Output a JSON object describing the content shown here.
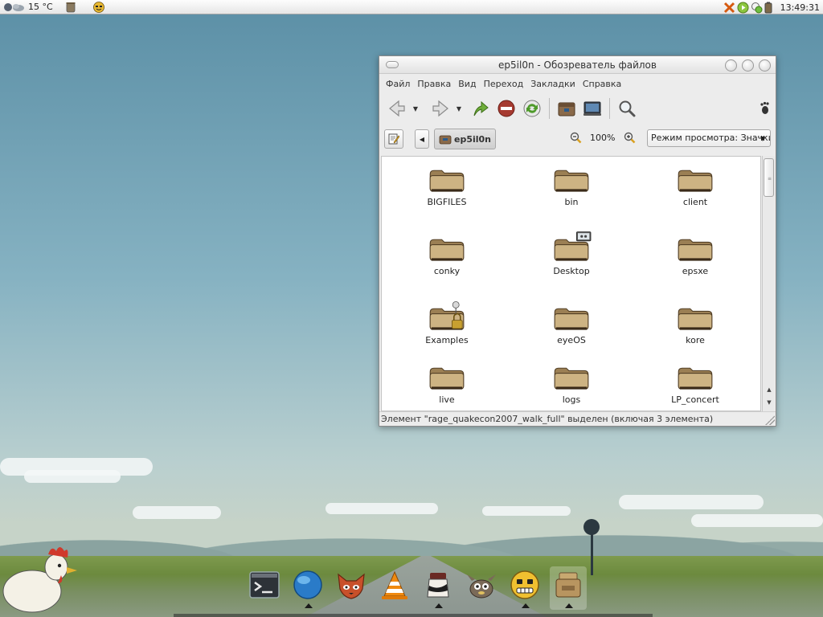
{
  "colors": {
    "desktop_sky": "#6f9fb3",
    "window_bg": "#ececec",
    "content_bg": "#ffffff",
    "folder": "#c8a870"
  },
  "panel": {
    "weather_icon": "weather-icon",
    "temperature": "15 °C",
    "tray_icons": [
      "close-x-icon",
      "play-icon",
      "network-icon",
      "battery-icon"
    ],
    "clock": "13:49:31"
  },
  "window": {
    "title": "ep5il0n - Обозреватель файлов",
    "menu": [
      "Файл",
      "Правка",
      "Вид",
      "Переход",
      "Закладки",
      "Справка"
    ],
    "toolbar": [
      "back-icon",
      "forward-icon",
      "up-icon",
      "stop-icon",
      "reload-icon",
      "home-icon",
      "computer-icon",
      "search-icon"
    ],
    "location": {
      "crumb": "ep5il0n",
      "zoom": "100%",
      "view_mode": "Режим просмотра: Значки"
    },
    "files": [
      {
        "name": "BIGFILES",
        "emblem": ""
      },
      {
        "name": "bin",
        "emblem": ""
      },
      {
        "name": "client",
        "emblem": ""
      },
      {
        "name": "conky",
        "emblem": ""
      },
      {
        "name": "Desktop",
        "emblem": "desktop-emblem-icon"
      },
      {
        "name": "epsxe",
        "emblem": ""
      },
      {
        "name": "Examples",
        "emblem": "lock-emblem-icon"
      },
      {
        "name": "eyeOS",
        "emblem": ""
      },
      {
        "name": "kore",
        "emblem": ""
      },
      {
        "name": "live",
        "emblem": ""
      },
      {
        "name": "logs",
        "emblem": ""
      },
      {
        "name": "LP_concert",
        "emblem": ""
      }
    ],
    "status": "Элемент \"rage_quakecon2007_walk_full\" выделен (включая 3 элемента)"
  },
  "dock": [
    "terminal-icon",
    "browser-globe-icon",
    "firefox-icon",
    "vlc-icon",
    "inkscape-icon",
    "gimp-icon",
    "pidgin-icon",
    "home-folder-icon"
  ]
}
